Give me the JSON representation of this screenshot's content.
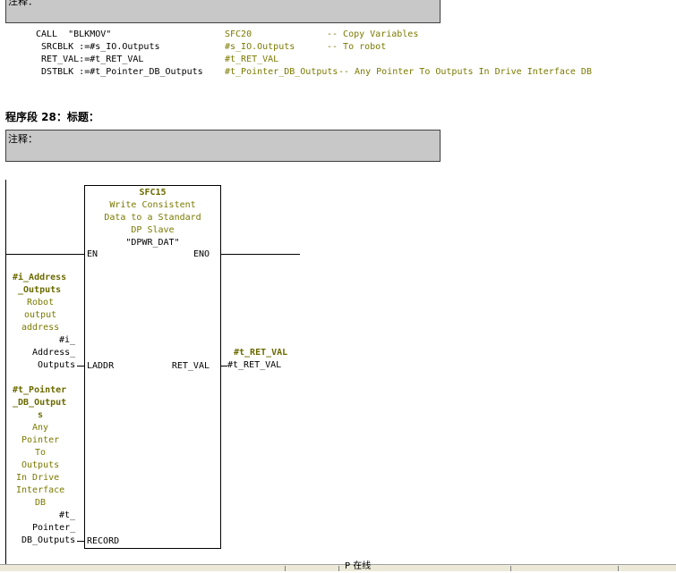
{
  "top_comment": {
    "label": "注释："
  },
  "call_block": {
    "lines": [
      {
        "code": "CALL  \"BLKMOV\"",
        "symbol": "SFC20",
        "comment": "-- Copy Variables"
      },
      {
        "code": "  SRCBLK :=#s_IO.Outputs",
        "symbol": "#s_IO.Outputs",
        "comment": "-- To robot"
      },
      {
        "code": "  RET_VAL:=#t_RET_VAL",
        "symbol": "#t_RET_VAL",
        "comment": ""
      },
      {
        "code": "  DSTBLK :=#t_Pointer_DB_Outputs",
        "symbol": "#t_Pointer_DB_Outputs",
        "comment": "-- Any Pointer To Outputs In Drive Interface DB"
      }
    ]
  },
  "network": {
    "title": "程序段 28：标题：",
    "comment_label": "注释："
  },
  "fb": {
    "name": "SFC15",
    "desc_lines": [
      "Write Consistent",
      "Data to a Standard",
      "DP Slave"
    ],
    "quoted_name": "\"DPWR_DAT\"",
    "pins": {
      "en": "EN",
      "eno": "ENO",
      "laddr": "LADDR",
      "ret_val": "RET_VAL",
      "record": "RECORD"
    }
  },
  "laddr_param": {
    "symbol_lines": [
      "#i_Address",
      "_Outputs"
    ],
    "comment_lines": [
      "Robot",
      "output",
      "address"
    ],
    "operand_lines": [
      "#i_",
      "Address_",
      "Outputs"
    ]
  },
  "record_param": {
    "symbol_lines": [
      "#t_Pointer",
      "_DB_Output",
      "s"
    ],
    "comment_lines": [
      "Any",
      "Pointer",
      "To",
      "Outputs",
      "In Drive",
      "Interface",
      "DB"
    ],
    "operand_lines": [
      "#t_",
      "Pointer_",
      "DB_Outputs"
    ]
  },
  "ret_val_param": {
    "symbol": "#t_RET_VAL",
    "operand": "#t_RET_VAL"
  },
  "status_bar": {
    "text": "P 在线"
  }
}
